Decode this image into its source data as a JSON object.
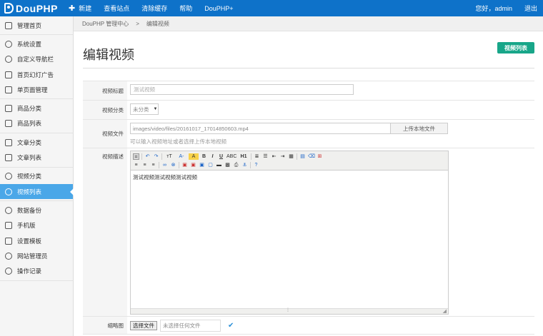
{
  "header": {
    "logo": "DouPHP",
    "nav": [
      {
        "label": "新建"
      },
      {
        "label": "查看站点"
      },
      {
        "label": "清除缓存"
      },
      {
        "label": "帮助"
      },
      {
        "label": "DouPHP+"
      }
    ],
    "greeting": "您好，admin",
    "logout": "退出"
  },
  "sidebar": {
    "groups": [
      [
        {
          "label": "管理首页",
          "icon": "home-icon"
        }
      ],
      [
        {
          "label": "系统设置",
          "icon": "gear-icon"
        },
        {
          "label": "自定义导航栏",
          "icon": "share-icon"
        },
        {
          "label": "首页幻灯广告",
          "icon": "image-icon"
        },
        {
          "label": "单页面管理",
          "icon": "page-icon"
        }
      ],
      [
        {
          "label": "商品分类",
          "icon": "folder-icon"
        },
        {
          "label": "商品列表",
          "icon": "grid-icon"
        }
      ],
      [
        {
          "label": "文章分类",
          "icon": "book-icon"
        },
        {
          "label": "文章列表",
          "icon": "document-icon"
        }
      ],
      [
        {
          "label": "视频分类",
          "icon": "circle-icon"
        },
        {
          "label": "视频列表",
          "icon": "circle-icon",
          "active": true
        }
      ],
      [
        {
          "label": "数据备份",
          "icon": "refresh-icon"
        },
        {
          "label": "手机版",
          "icon": "mobile-icon"
        },
        {
          "label": "设置模板",
          "icon": "template-icon"
        },
        {
          "label": "网站管理员",
          "icon": "user-icon"
        },
        {
          "label": "操作记录",
          "icon": "clock-icon"
        }
      ]
    ]
  },
  "breadcrumb": {
    "root": "DouPHP 管理中心",
    "separator": ">",
    "current": "编辑视频"
  },
  "page": {
    "title": "编辑视频",
    "list_button": "视频列表"
  },
  "form": {
    "title_label": "视频标题",
    "title_value": "测试视频",
    "category_label": "视频分类",
    "category_value": "未分类",
    "file_label": "视频文件",
    "file_value": "images/video/files/20161017_17014850603.mp4",
    "upload_label": "上传本地文件",
    "file_hint": "可以输入视频地址或者选择上传本地视频",
    "desc_label": "视频描述",
    "desc_content": "测试视频测试视频测试视频",
    "thumb_label": "缩略图",
    "choose_file": "选择文件",
    "no_file": "未选择任何文件"
  },
  "colors": {
    "topbar": "#0e72c9",
    "active_sidebar": "#4aa7e8",
    "list_button": "#18a689"
  }
}
